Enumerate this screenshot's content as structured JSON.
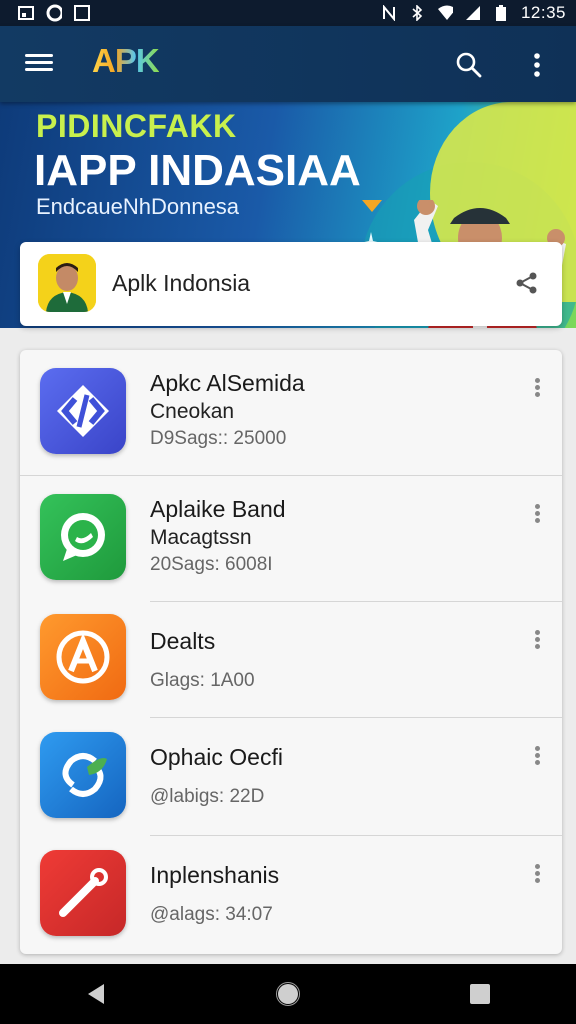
{
  "status_bar": {
    "time": "12:35",
    "icons": [
      "image-icon",
      "circle-icon",
      "square-icon",
      "no-notification-icon",
      "bluetooth-icon",
      "wifi-icon",
      "signal-icon",
      "battery-icon"
    ]
  },
  "app_bar": {
    "logo": "APK",
    "icons": [
      "menu-icon",
      "search-icon",
      "more-vert-icon"
    ]
  },
  "banner": {
    "line1": "PIDINCFAKK",
    "line2": "IAPP INDASIAA",
    "line3": "EndcaueNhDonnesa"
  },
  "profile": {
    "name": "Aplk Indonsia",
    "share_icon": "share-icon"
  },
  "apps": [
    {
      "name": "Apkc AlSemida",
      "sub": "Cneokan",
      "meta": "D9Sags:: 25000",
      "icon": "code-arrows-icon",
      "color": "#4a5fe0"
    },
    {
      "name": "Aplaike Band",
      "sub": "Macagtssn",
      "meta": "20Sags: 6008I",
      "icon": "chat-bubble-icon",
      "color": "#2bb34a"
    },
    {
      "name": "Dealts",
      "sub": "",
      "meta": "Glags: 1A00",
      "icon": "letter-a-icon",
      "color": "#f57c1f"
    },
    {
      "name": "Ophaic Oecfi",
      "sub": "",
      "meta": "@labigs: 22D",
      "icon": "leaf-loop-icon",
      "color": "#1e88e5"
    },
    {
      "name": "Inplenshanis",
      "sub": "",
      "meta": "@alags: 34:07",
      "icon": "pen-tool-icon",
      "color": "#e53935"
    }
  ],
  "nav_bar": {
    "icons": [
      "back-icon",
      "home-icon",
      "recents-icon"
    ]
  },
  "colors": {
    "app_bar": "#123a63",
    "status_bar": "#0d1b2e",
    "banner_accent": "#c8f04d"
  }
}
